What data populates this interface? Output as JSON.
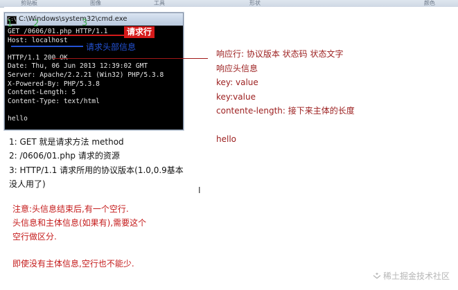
{
  "ribbon": {
    "items": [
      "剪贴板",
      "图像",
      "工具",
      "形状",
      "颜色"
    ]
  },
  "cmd": {
    "title": "C:\\Windows\\system32\\cmd.exe",
    "icon_text": "C:\\",
    "lines": [
      "GET /0606/01.php HTTP/1.1",
      "Host: localhost",
      "",
      "HTTP/1.1 200 OK",
      "Date: Thu, 06 Jun 2013 12:39:02 GMT",
      "Server: Apache/2.2.21 (Win32) PHP/5.3.8",
      "X-Powered-By: PHP/5.3.8",
      "Content-Length: 5",
      "Content-Type: text/html",
      "",
      "hello"
    ]
  },
  "annotations": {
    "request_line_tag": "请求行",
    "request_header_tag": "请求头部信息",
    "marks": [
      "1",
      "2",
      "3"
    ]
  },
  "response_notes": [
    "响应行: 协议版本 状态码 状态文字",
    "响应头信息",
    "key: value",
    "key:value",
    "contente-length: 接下来主体的长度",
    "",
    "hello"
  ],
  "explanations": [
    "1: GET 就是请求方法 method",
    "2: /0606/01.php 请求的资源",
    "3: HTTP/1.1 请求所用的协议版本(1.0,0.9基本",
    "没人用了)"
  ],
  "notes": [
    "注意:头信息结束后,有一个空行.",
    "头信息和主体信息(如果有),需要这个",
    "空行做区分.",
    "",
    "即使没有主体信息,空行也不能少."
  ],
  "watermark": "稀土掘金技术社区",
  "colors": {
    "annotation_red": "#d61a1a",
    "annotation_blue": "#2453d6",
    "response_text": "#9b1d1d",
    "note_text": "#c41a1a"
  }
}
